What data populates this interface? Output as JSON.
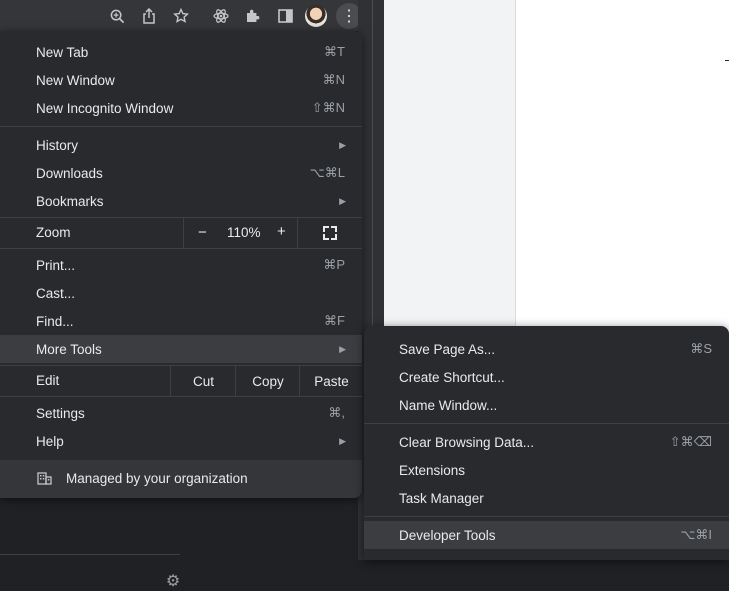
{
  "toolbar": {
    "icons": [
      "zoom-icon",
      "share-icon",
      "bookmark-star-icon",
      "react-devtools-icon",
      "extensions-icon",
      "side-panel-icon",
      "avatar",
      "more-icon"
    ]
  },
  "menu": {
    "new_tab": {
      "label": "New Tab",
      "shortcut": "⌘T"
    },
    "new_window": {
      "label": "New Window",
      "shortcut": "⌘N"
    },
    "new_incognito": {
      "label": "New Incognito Window",
      "shortcut": "⇧⌘N"
    },
    "history": {
      "label": "History"
    },
    "downloads": {
      "label": "Downloads",
      "shortcut": "⌥⌘L"
    },
    "bookmarks": {
      "label": "Bookmarks"
    },
    "zoom": {
      "label": "Zoom",
      "minus": "−",
      "value": "110%",
      "plus": "+"
    },
    "print": {
      "label": "Print...",
      "shortcut": "⌘P"
    },
    "cast": {
      "label": "Cast..."
    },
    "find": {
      "label": "Find...",
      "shortcut": "⌘F"
    },
    "more_tools": {
      "label": "More Tools"
    },
    "edit": {
      "label": "Edit",
      "cut": "Cut",
      "copy": "Copy",
      "paste": "Paste"
    },
    "settings": {
      "label": "Settings",
      "shortcut": "⌘,"
    },
    "help": {
      "label": "Help"
    },
    "managed": {
      "label": "Managed by your organization"
    }
  },
  "submenu": {
    "save_page": {
      "label": "Save Page As...",
      "shortcut": "⌘S"
    },
    "create_shortcut": {
      "label": "Create Shortcut..."
    },
    "name_window": {
      "label": "Name Window..."
    },
    "clear_data": {
      "label": "Clear Browsing Data...",
      "shortcut": "⇧⌘⌫"
    },
    "extensions": {
      "label": "Extensions"
    },
    "task_manager": {
      "label": "Task Manager"
    },
    "developer_tools": {
      "label": "Developer Tools",
      "shortcut": "⌥⌘I"
    }
  },
  "colors": {
    "menu_bg": "#292a2d",
    "highlight": "#3c3d41",
    "text": "#e8eaed",
    "shortcut_text": "#9aa0a6"
  }
}
